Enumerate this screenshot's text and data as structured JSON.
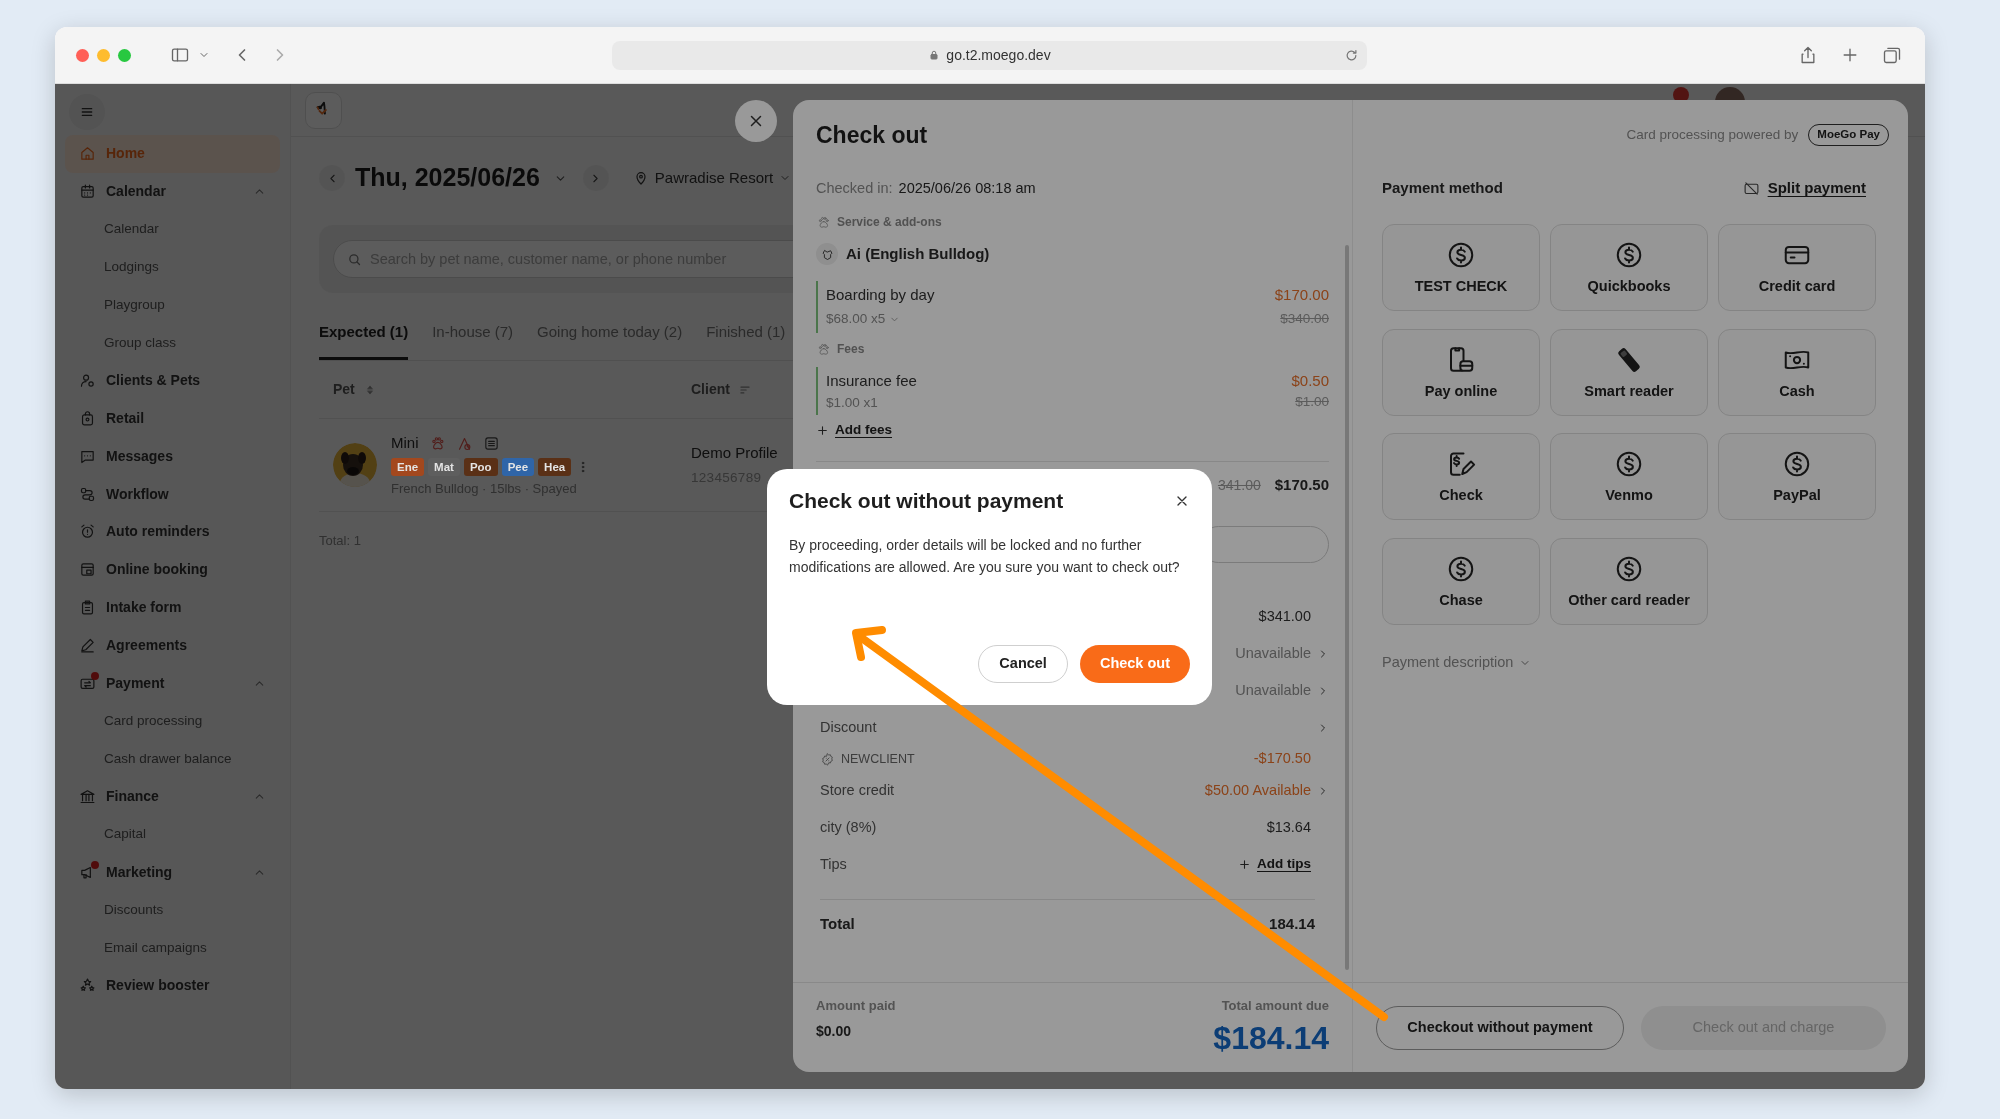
{
  "browser": {
    "url": "go.t2.moego.dev"
  },
  "sidebar": {
    "items": [
      {
        "label": "Home",
        "selected": true,
        "alert": false
      },
      {
        "label": "Calendar",
        "selected": false,
        "alert": false,
        "expanded": true,
        "children": [
          {
            "label": "Calendar"
          },
          {
            "label": "Lodgings"
          },
          {
            "label": "Playgroup"
          },
          {
            "label": "Group class"
          }
        ]
      },
      {
        "label": "Clients & Pets",
        "selected": false,
        "alert": false
      },
      {
        "label": "Retail",
        "selected": false,
        "alert": false
      },
      {
        "label": "Messages",
        "selected": false,
        "alert": false
      },
      {
        "label": "Workflow",
        "selected": false,
        "alert": false
      },
      {
        "label": "Auto reminders",
        "selected": false,
        "alert": false
      },
      {
        "label": "Online booking",
        "selected": false,
        "alert": false
      },
      {
        "label": "Intake form",
        "selected": false,
        "alert": false
      },
      {
        "label": "Agreements",
        "selected": false,
        "alert": false
      },
      {
        "label": "Payment",
        "selected": false,
        "alert": true,
        "expanded": true,
        "children": [
          {
            "label": "Card processing"
          },
          {
            "label": "Cash drawer balance"
          }
        ]
      },
      {
        "label": "Finance",
        "selected": false,
        "alert": false,
        "expanded": true,
        "children": [
          {
            "label": "Capital"
          }
        ]
      },
      {
        "label": "Marketing",
        "selected": false,
        "alert": true,
        "expanded": true,
        "children": [
          {
            "label": "Discounts"
          },
          {
            "label": "Email campaigns"
          }
        ]
      },
      {
        "label": "Review booster",
        "selected": false,
        "alert": false
      }
    ]
  },
  "main": {
    "date": "Thu, 2025/06/26",
    "location": "Pawradise Resort",
    "search": {
      "placeholder": "Search by pet name, customer name, or phone number"
    },
    "tabs": [
      {
        "label": "Expected (1)",
        "selected": true
      },
      {
        "label": "In-house (7)",
        "selected": false
      },
      {
        "label": "Going home today (2)",
        "selected": false
      },
      {
        "label": "Finished (1)",
        "selected": false
      }
    ],
    "table": {
      "columns": [
        "Pet",
        "Client"
      ],
      "rows": [
        {
          "pet_name": "Mini",
          "tags": [
            {
              "label": "Ene",
              "color": "#a3481e"
            },
            {
              "label": "Mat",
              "color": "#5e5e5e"
            },
            {
              "label": "Poo",
              "color": "#5a3016"
            },
            {
              "label": "Pee",
              "color": "#2f65a8"
            },
            {
              "label": "Hea",
              "color": "#5a3016"
            }
          ],
          "pet_details": "French Bulldog · 15lbs · Spayed",
          "client_name": "Demo Profile",
          "client_phone": "123456789"
        }
      ]
    },
    "total": "Total: 1"
  },
  "checkout": {
    "title": "Check out",
    "checked_in_label": "Checked in:",
    "checked_in": "2025/06/26 08:18 am",
    "sections": [
      {
        "title": "Service & add-ons",
        "pet": "Ai (English Bulldog)",
        "items": [
          {
            "name": "Boarding by day",
            "detail": "$68.00 x5",
            "expandable": true,
            "price": "$170.00",
            "original_price": "$340.00"
          }
        ]
      },
      {
        "title": "Fees",
        "items": [
          {
            "name": "Insurance fee",
            "detail": "$1.00 x1",
            "expandable": false,
            "price": "$0.50",
            "original_price": "$1.00"
          }
        ],
        "add_link": "Add fees"
      }
    ],
    "subtotal": {
      "original": "341.00",
      "value": "$170.50"
    },
    "summary": [
      {
        "kind": "line",
        "value": "$341.00",
        "highlighted": false,
        "disabled": false,
        "chevron": false
      },
      {
        "kind": "line",
        "value": "Unavailable",
        "highlighted": false,
        "disabled": true,
        "chevron": true
      },
      {
        "kind": "line",
        "value": "Unavailable",
        "highlighted": false,
        "disabled": true,
        "chevron": true
      },
      {
        "kind": "line",
        "label": "Discount",
        "chevron": true
      },
      {
        "kind": "code",
        "label": "NEWCLIENT",
        "value": "-$170.50",
        "highlighted": true,
        "disabled": false,
        "chevron": false
      },
      {
        "kind": "line",
        "label": "Store credit",
        "value": "$50.00 Available",
        "highlighted": true,
        "disabled": false,
        "chevron": true
      },
      {
        "kind": "line",
        "label": "city (8%)",
        "value": "$13.64",
        "highlighted": false,
        "disabled": false,
        "chevron": false
      },
      {
        "kind": "action",
        "label": "Tips",
        "action": "Add tips"
      }
    ],
    "total": {
      "label": "Total",
      "value": "184.14"
    },
    "footer": {
      "paid_label": "Amount paid",
      "paid": "$0.00",
      "due_label": "Total amount due",
      "due": "$184.14"
    }
  },
  "payment": {
    "powered_by": "Card processing powered by",
    "provider_logo": "MoeGo Pay",
    "title": "Payment method",
    "split_link": "Split payment",
    "methods": [
      {
        "label": "TEST CHECK"
      },
      {
        "label": "Quickbooks"
      },
      {
        "label": "Credit card"
      },
      {
        "label": "Pay online"
      },
      {
        "label": "Smart reader"
      },
      {
        "label": "Cash"
      },
      {
        "label": "Check"
      },
      {
        "label": "Venmo"
      },
      {
        "label": "PayPal"
      },
      {
        "label": "Chase"
      },
      {
        "label": "Other card reader"
      }
    ],
    "description_toggle": "Payment description",
    "buttons": [
      {
        "label": "Checkout without payment",
        "disabled": false
      },
      {
        "label": "Check out and charge",
        "disabled": true
      }
    ]
  },
  "dialog": {
    "title": "Check out without payment",
    "message": "By proceeding, order details will be locked and no further modifications are allowed. Are you sure you want to check out?",
    "buttons": [
      {
        "label": "Cancel",
        "kind": "secondary"
      },
      {
        "label": "Check out",
        "kind": "primary"
      }
    ]
  }
}
